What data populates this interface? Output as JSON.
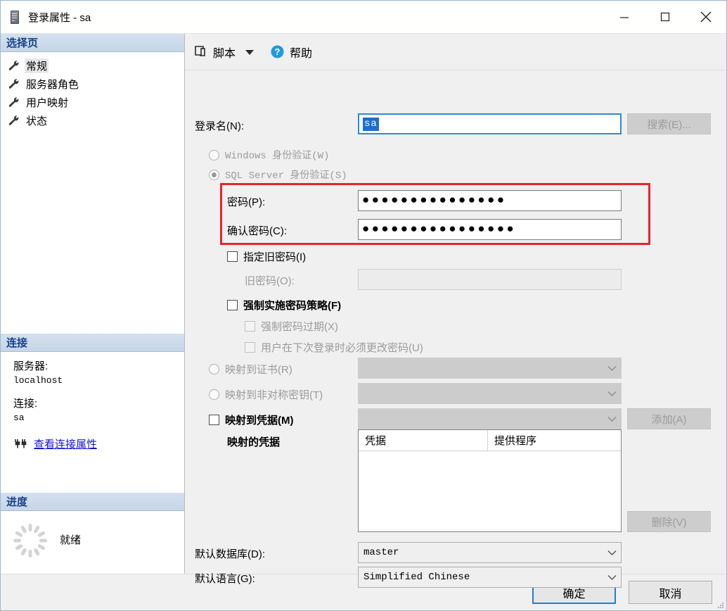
{
  "window": {
    "title": "登录属性 - sa",
    "icon": "server-icon",
    "controls": {
      "minimize": "–",
      "maximize": "□",
      "close": "✕"
    }
  },
  "sidebar": {
    "pages_header": "选择页",
    "pages": [
      {
        "label": "常规",
        "icon": "wrench-icon",
        "selected": true
      },
      {
        "label": "服务器角色",
        "icon": "wrench-icon",
        "selected": false
      },
      {
        "label": "用户映射",
        "icon": "wrench-icon",
        "selected": false
      },
      {
        "label": "状态",
        "icon": "wrench-icon",
        "selected": false
      }
    ],
    "connection_header": "连接",
    "connection": {
      "server_label": "服务器:",
      "server_value": "localhost",
      "connection_label": "连接:",
      "connection_value": "sa",
      "view_props_link": "查看连接属性",
      "link_icon": "plug-icon"
    },
    "progress_header": "进度",
    "progress": {
      "status": "就绪",
      "icon": "spinner-icon"
    }
  },
  "toolbar": {
    "script_label": "脚本",
    "script_icon": "script-icon",
    "caret_icon": "chevron-down-icon",
    "help_label": "帮助",
    "help_icon": "help-circle-icon"
  },
  "form": {
    "login_name_label": "登录名(N):",
    "login_name_value": "sa",
    "search_button": "搜索(E)...",
    "auth_windows": "Windows 身份验证(W)",
    "auth_sql": "SQL Server 身份验证(S)",
    "password_label": "密码(P):",
    "password_value": "●●●●●●●●●●●●●●●",
    "confirm_password_label": "确认密码(C):",
    "confirm_password_value": "●●●●●●●●●●●●●●●●",
    "specify_old_password": "指定旧密码(I)",
    "old_password_label": "旧密码(O):",
    "old_password_value": "",
    "enforce_policy": "强制实施密码策略(F)",
    "enforce_expiration": "强制密码过期(X)",
    "must_change": "用户在下次登录时必须更改密码(U)",
    "map_certificate": "映射到证书(R)",
    "map_certificate_value": "",
    "map_asymmetric_key": "映射到非对称密钥(T)",
    "map_asymmetric_key_value": "",
    "map_credential": "映射到凭据(M)",
    "map_credential_value": "",
    "add_button": "添加(A)",
    "mapped_credentials_label": "映射的凭据",
    "grid_col_credential": "凭据",
    "grid_col_provider": "提供程序",
    "grid_rows": [],
    "remove_button": "删除(V)",
    "default_database_label": "默认数据库(D):",
    "default_database_value": "master",
    "default_language_label": "默认语言(G):",
    "default_language_value": "Simplified Chinese"
  },
  "footer": {
    "ok_button": "确定",
    "cancel_button": "取消"
  },
  "colors": {
    "accent": "#1c6fd0",
    "highlight_box": "#e8262c",
    "link": "#1414cd",
    "section_header_text": "#15428b"
  }
}
